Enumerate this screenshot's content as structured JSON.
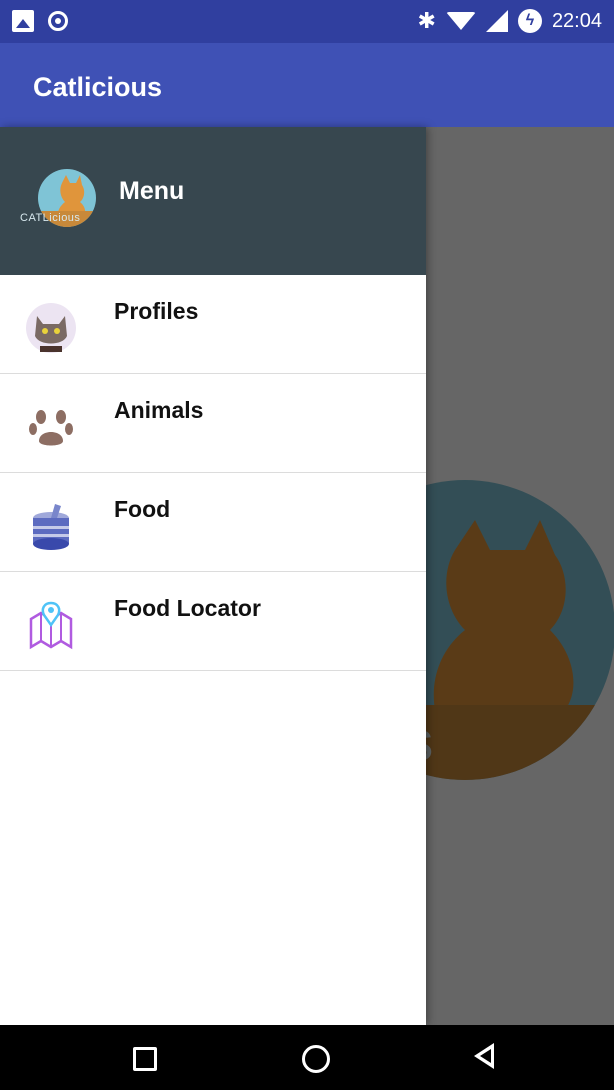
{
  "statusbar": {
    "time": "22:04"
  },
  "appbar": {
    "title": "Catlicious"
  },
  "drawer": {
    "header": {
      "title": "Menu",
      "avatar_text": "CATLicious"
    },
    "items": [
      {
        "label": "Profiles",
        "icon": "cat-face-icon"
      },
      {
        "label": "Animals",
        "icon": "paw-icon"
      },
      {
        "label": "Food",
        "icon": "food-can-icon"
      },
      {
        "label": "Food Locator",
        "icon": "map-pin-icon"
      }
    ]
  },
  "background": {
    "logo_text": "ous"
  },
  "colors": {
    "status": "#303f9f",
    "appbar": "#3f51b5",
    "drawer_header": "#37474f"
  }
}
